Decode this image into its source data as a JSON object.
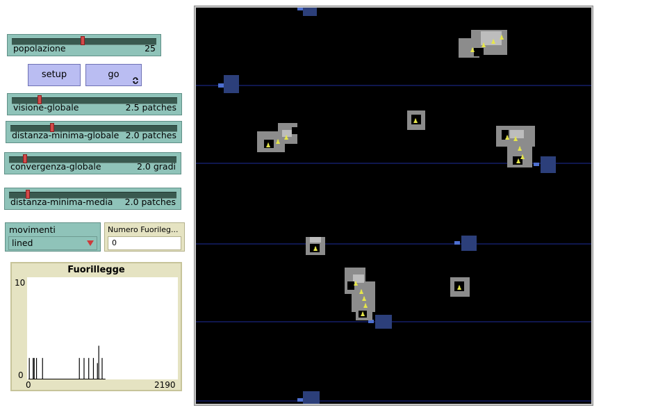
{
  "sliders": {
    "popolazione": {
      "label": "popolazione",
      "value": "25",
      "fraction": 0.5
    },
    "visione_globale": {
      "label": "visione-globale",
      "value": "2.5 patches",
      "fraction": 0.17
    },
    "distanza_minima_globale": {
      "label": "distanza-minima-globale",
      "value": "2.0 patches",
      "fraction": 0.24
    },
    "convergenza_globale": {
      "label": "convergenza-globale",
      "value": "2.0 gradi",
      "fraction": 0.1
    },
    "distanza_minima_media": {
      "label": "distanza-minima-media",
      "value": "2.0 patches",
      "fraction": 0.1
    }
  },
  "buttons": {
    "setup": "setup",
    "go": "go"
  },
  "chooser": {
    "label": "movimenti",
    "value": "lined"
  },
  "monitor": {
    "label": "Numero Fuorileg...",
    "value": "0"
  },
  "plot": {
    "title": "Fuorillegge",
    "ymax": "10",
    "ymin": "0",
    "xmin": "0",
    "xmax": "2190"
  },
  "chart_data": {
    "type": "bar",
    "title": "Fuorillegge",
    "xlim": [
      0,
      2190
    ],
    "ylim": [
      0,
      10
    ],
    "x": [
      12,
      70,
      85,
      120,
      210,
      760,
      830,
      900,
      970,
      1030,
      1050,
      1100
    ],
    "values": [
      2.1,
      2.1,
      2.1,
      2.1,
      2.1,
      2.1,
      2.1,
      2.1,
      2.1,
      1.6,
      3.3,
      2.1
    ]
  },
  "colors": {
    "world_background": "#000000",
    "lane_line": "#1e2e9c",
    "flock_body": "#8c8c8c",
    "flock_light": "#bdbdbd",
    "agent_yellow": "#e6e64a",
    "ship_blue": "#2c3f7a",
    "ship_light": "#4d6fd0"
  }
}
